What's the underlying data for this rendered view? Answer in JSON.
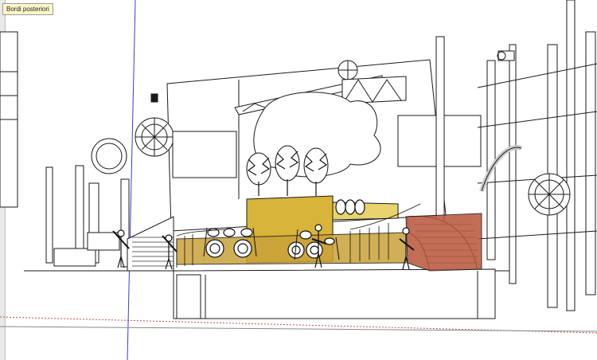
{
  "viewport": {
    "tooltip_text": "Bordi posteriori",
    "axis_colors": {
      "vertical": "#3b3bd6",
      "horizontal": "#c24b4b"
    },
    "scene": {
      "stage_backdrop_color": "#d8b43a",
      "stage_floor_color": "#c9a23a",
      "right_wall_color": "#b8553a",
      "line_color": "#1a1a1a"
    }
  }
}
